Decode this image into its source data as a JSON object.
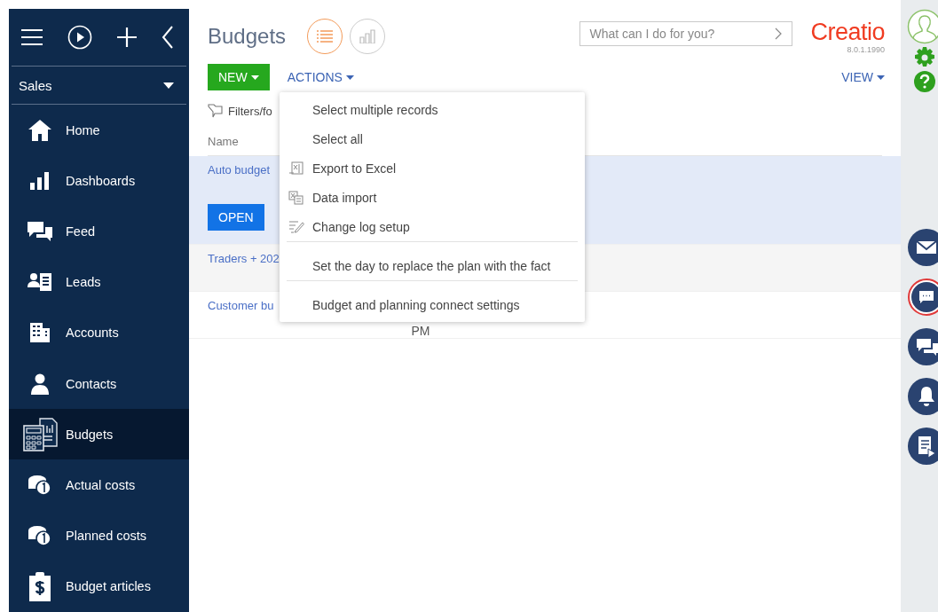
{
  "sidebar": {
    "section": "Sales",
    "items": [
      {
        "label": "Home",
        "selected": false
      },
      {
        "label": "Dashboards",
        "selected": false
      },
      {
        "label": "Feed",
        "selected": false
      },
      {
        "label": "Leads",
        "selected": false
      },
      {
        "label": "Accounts",
        "selected": false
      },
      {
        "label": "Contacts",
        "selected": false
      },
      {
        "label": "Budgets",
        "selected": true
      },
      {
        "label": "Actual costs",
        "selected": false
      },
      {
        "label": "Planned costs",
        "selected": false
      },
      {
        "label": "Budget articles",
        "selected": false
      }
    ]
  },
  "header": {
    "title": "Budgets",
    "views": [
      {
        "selected": true
      },
      {
        "selected": false
      }
    ],
    "search": {
      "placeholder": "What can I do for you?"
    },
    "logo": "Creatio",
    "version": "8.0.1.1990"
  },
  "toolbar": {
    "new_button": "NEW",
    "actions_button": "ACTIONS",
    "view_button": "VIEW"
  },
  "filters": "Filters/fo",
  "table": {
    "column_heading": "Name",
    "open_button": "OPEN",
    "rows": [
      {
        "name": "Auto budget",
        "selected": true
      },
      {
        "name": "Traders + 202",
        "selected": false
      },
      {
        "name": "Customer bu",
        "selected": false,
        "column_2": "PM"
      }
    ]
  },
  "actions_menu": [
    {
      "label": "Select multiple records",
      "divider_before": false
    },
    {
      "label": "Select all",
      "divider_before": false
    },
    {
      "label": "Export to Excel",
      "divider_before": false
    },
    {
      "label": "Data import",
      "divider_before": false
    },
    {
      "label": "Change log setup",
      "divider_before": false
    },
    {
      "label": "Set the day to replace the plan with the fact",
      "divider_before": true
    },
    {
      "label": "Budget and planning connect settings",
      "divider_before": true
    }
  ]
}
